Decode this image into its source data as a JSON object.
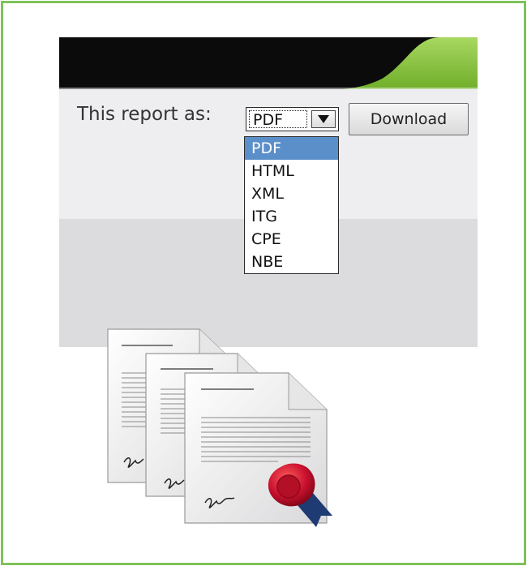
{
  "report": {
    "label": "This report as:",
    "selected": "PDF",
    "download_label": "Download"
  },
  "formats": [
    "PDF",
    "HTML",
    "XML",
    "ITG",
    "CPE",
    "NBE"
  ],
  "colors": {
    "frame_border": "#7fc25a",
    "header_dark": "#0a0a0a",
    "header_green": "#8cc63f",
    "selected_option": "#5b8fc9",
    "seal_red": "#c8102e"
  },
  "icons": [
    "dropdown-arrow-icon",
    "documents-icon",
    "wax-seal-icon"
  ]
}
